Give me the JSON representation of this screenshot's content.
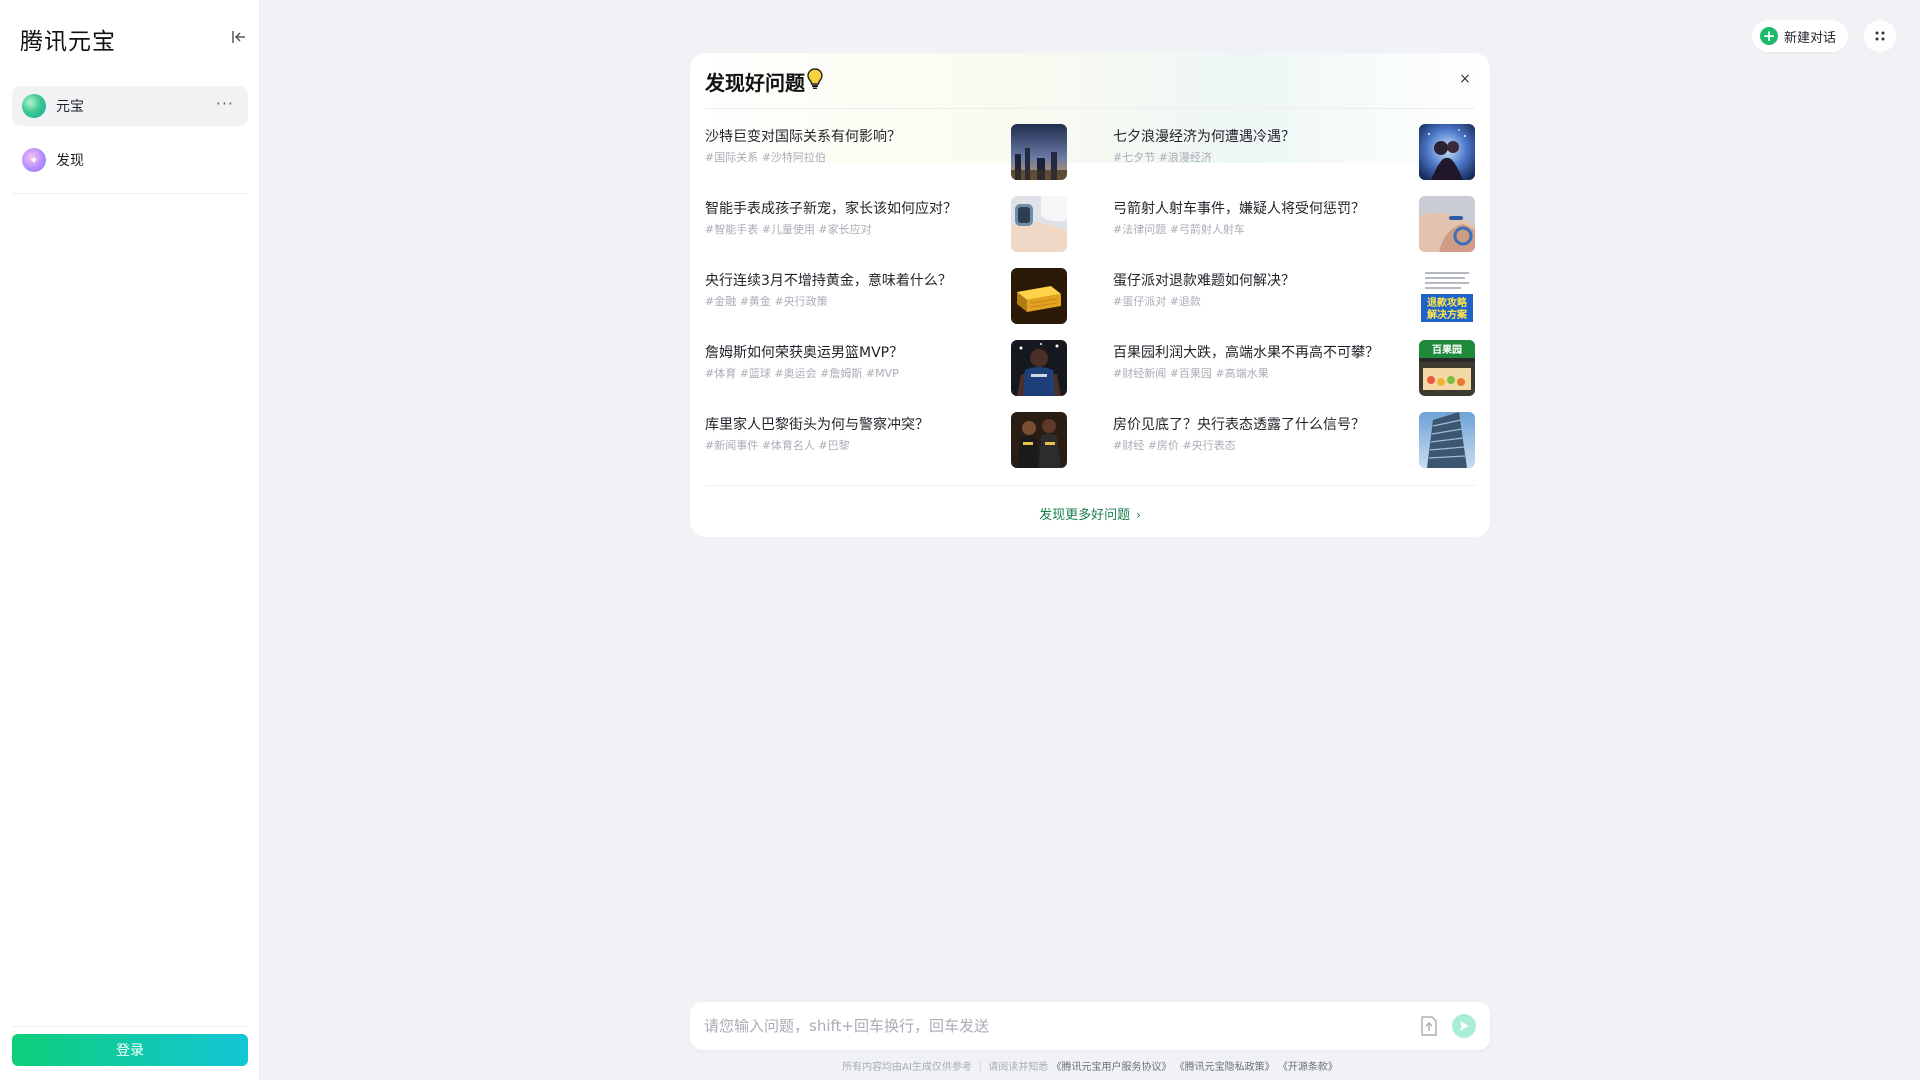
{
  "sidebar": {
    "brand": "腾讯元宝",
    "items": [
      {
        "label": "元宝",
        "more": "···"
      },
      {
        "label": "发现"
      }
    ],
    "login_label": "登录"
  },
  "topbar": {
    "new_chat_label": "新建对话"
  },
  "discover": {
    "title": "发现好问题",
    "close": "×",
    "questions": [
      {
        "title": "沙特巨变对国际关系有何影响？",
        "tags": "#国际关系 #沙特阿拉伯"
      },
      {
        "title": "七夕浪漫经济为何遭遇冷遇？",
        "tags": "#七夕节 #浪漫经济"
      },
      {
        "title": "智能手表成孩子新宠，家长该如何应对？",
        "tags": "#智能手表 #儿童使用 #家长应对"
      },
      {
        "title": "弓箭射人射车事件，嫌疑人将受何惩罚？",
        "tags": "#法律问题 #弓箭射人射车"
      },
      {
        "title": "央行连续3月不增持黄金，意味着什么？",
        "tags": "#金融 #黄金 #央行政策"
      },
      {
        "title": "蛋仔派对退款难题如何解决？",
        "tags": "#蛋仔派对 #退款"
      },
      {
        "title": "詹姆斯如何荣获奥运男篮MVP？",
        "tags": "#体育 #篮球 #奥运会 #詹姆斯 #MVP"
      },
      {
        "title": "百果园利润大跌，高端水果不再高不可攀？",
        "tags": "#财经新闻 #百果园 #高端水果"
      },
      {
        "title": "库里家人巴黎街头为何与警察冲突？",
        "tags": "#新闻事件 #体育名人 #巴黎"
      },
      {
        "title": "房价见底了？央行表态透露了什么信号？",
        "tags": "#财经 #房价 #央行表态"
      }
    ],
    "thumb_texts": {
      "refund_line1": "退款攻略",
      "refund_line2": "解决方案",
      "shop_sign": "百果园"
    },
    "more_label": "发现更多好问题",
    "more_chevron": "›"
  },
  "input": {
    "placeholder": "请您输入问题，shift+回车换行，回车发送"
  },
  "footer": {
    "disclaimer": "所有内容均由AI生成仅供参考 ｜ 请阅读并知悉",
    "links": [
      "《腾讯元宝用户服务协议》",
      "《腾讯元宝隐私政策》",
      "《开源条款》"
    ]
  },
  "colors": {
    "accent_green": "#1dbb69",
    "link_green": "#1a7f4e",
    "background": "#f1f2f6"
  }
}
